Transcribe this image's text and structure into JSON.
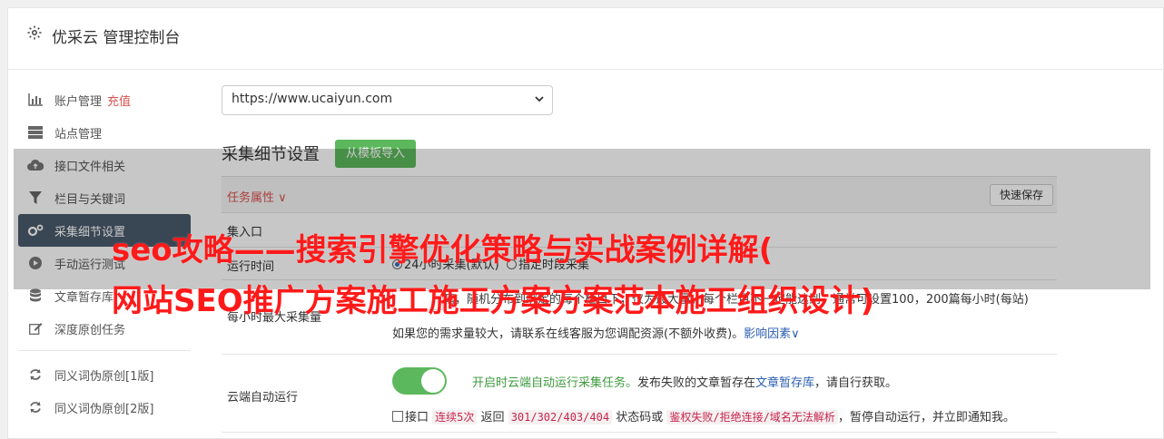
{
  "header": {
    "title": "优采云 管理控制台"
  },
  "sidebar": {
    "items": [
      {
        "label": "账户管理",
        "extra": "充值",
        "icon": "bar-chart-icon"
      },
      {
        "label": "站点管理",
        "icon": "server-icon"
      },
      {
        "label": "接口文件相关",
        "icon": "cloud-upload-icon"
      },
      {
        "label": "栏目与关键词",
        "icon": "filter-icon"
      },
      {
        "label": "采集细节设置",
        "icon": "gears-icon",
        "active": true
      },
      {
        "label": "手动运行测试",
        "icon": "play-circle-icon"
      },
      {
        "label": "文章暂存库",
        "icon": "database-icon"
      },
      {
        "label": "深度原创任务",
        "icon": "edit-icon"
      }
    ],
    "items2": [
      {
        "label": "同义词伪原创[1版]",
        "icon": "refresh-icon"
      },
      {
        "label": "同义词伪原创[2版]",
        "icon": "refresh-icon"
      }
    ]
  },
  "main": {
    "site_select": {
      "value": "https://www.ucaiyun.com"
    },
    "section_title": "采集细节设置",
    "import_button": "从模板导入",
    "task_attr": "任务属性",
    "quick_save": "快速保存",
    "rows": {
      "entry": {
        "label": "集入口"
      },
      "runtime": {
        "label": "运行时间",
        "opt1": "24小时采集(默认)",
        "opt2": "指定时段采集"
      },
      "max": {
        "label": "每小时最大采集量",
        "line1": "篇，随机分布到绑定的每个栏目下，仅为最大量，每个栏目不一定能达到，通常可设置100，200篇每小时(每站)",
        "line2_pre": "如果您的需求量较大，请联系在线客服为您调配资源(不额外收费)。",
        "line2_link": "影响因素"
      },
      "cloud": {
        "label": "云端自动运行",
        "desc_green": "开启时云端自动运行采集任务。",
        "desc_mid": "发布失败的文章暂存在",
        "desc_link": "文章暂存库",
        "desc_end": "，请自行获取。",
        "chk_pre": "接口",
        "tag1": "连续5次",
        "mid1": "返回",
        "tag2": "301/302/403/404",
        "mid2": "状态码或",
        "tag3": "鉴权失败/拒绝连接/域名无法解析",
        "end": "，暂停自动运行，并立即通知我。"
      }
    }
  },
  "overlay": {
    "line1": "seo攻略——搜索引擎优化策略与实战案例详解(",
    "line2": "网站SEO推广方案施工施工方案方案范本施工组织设计)"
  },
  "colors": {
    "accent_green": "#5cb85c",
    "active_sidebar": "#4a5a6b",
    "headline_red": "#ff1a1a",
    "link_blue": "#2a5db0"
  }
}
